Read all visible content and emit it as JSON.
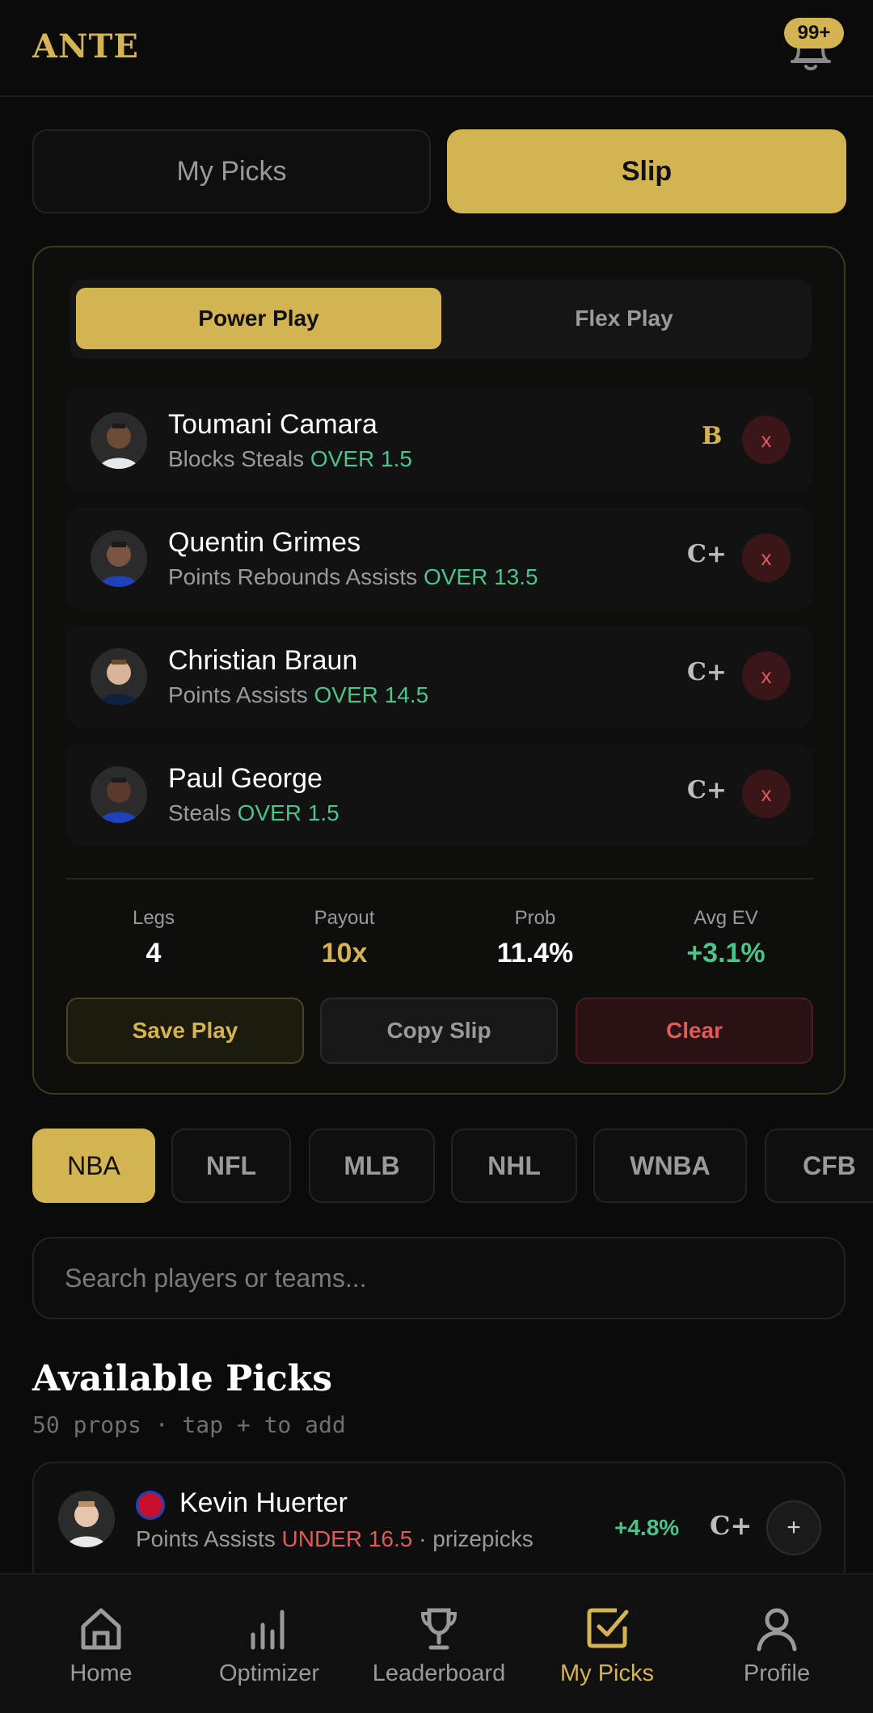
{
  "app": {
    "brand": "ANTE",
    "notif_badge": "99+"
  },
  "top_tabs": {
    "my_picks": "My Picks",
    "slip": "Slip"
  },
  "slip": {
    "play_modes": {
      "power": "Power Play",
      "flex": "Flex Play"
    },
    "picks": [
      {
        "name": "Toumani Camara",
        "market": "Blocks Steals",
        "line": "OVER 1.5",
        "grade": "B",
        "remove": "x"
      },
      {
        "name": "Quentin Grimes",
        "market": "Points Rebounds Assists",
        "line": "OVER 13.5",
        "grade": "C+",
        "remove": "x"
      },
      {
        "name": "Christian Braun",
        "market": "Points Assists",
        "line": "OVER 14.5",
        "grade": "C+",
        "remove": "x"
      },
      {
        "name": "Paul George",
        "market": "Steals",
        "line": "OVER 1.5",
        "grade": "C+",
        "remove": "x"
      }
    ],
    "stats": {
      "legs": {
        "label": "Legs",
        "value": "4"
      },
      "payout": {
        "label": "Payout",
        "value": "10x"
      },
      "prob": {
        "label": "Prob",
        "value": "11.4%"
      },
      "avg_ev": {
        "label": "Avg EV",
        "value": "+3.1%"
      }
    },
    "actions": {
      "save": "Save Play",
      "copy": "Copy Slip",
      "clear": "Clear"
    }
  },
  "leagues": [
    "NBA",
    "NFL",
    "MLB",
    "NHL",
    "WNBA",
    "CFB"
  ],
  "search": {
    "placeholder": "Search players or teams..."
  },
  "available": {
    "title": "Available Picks",
    "subtitle": "50 props · tap + to add",
    "items": [
      {
        "name": "Kevin Huerter",
        "market": "Points Assists",
        "line": "UNDER 16.5",
        "source": "· prizepicks",
        "ev": "+4.8%",
        "grade": "C+",
        "add": "+"
      }
    ]
  },
  "nav": {
    "home": "Home",
    "optimizer": "Optimizer",
    "leaderboard": "Leaderboard",
    "my_picks": "My Picks",
    "profile": "Profile"
  },
  "colors": {
    "accent": "#d4b452",
    "positive": "#4cc38a",
    "negative": "#e05a5a",
    "background": "#0b0b0b"
  }
}
